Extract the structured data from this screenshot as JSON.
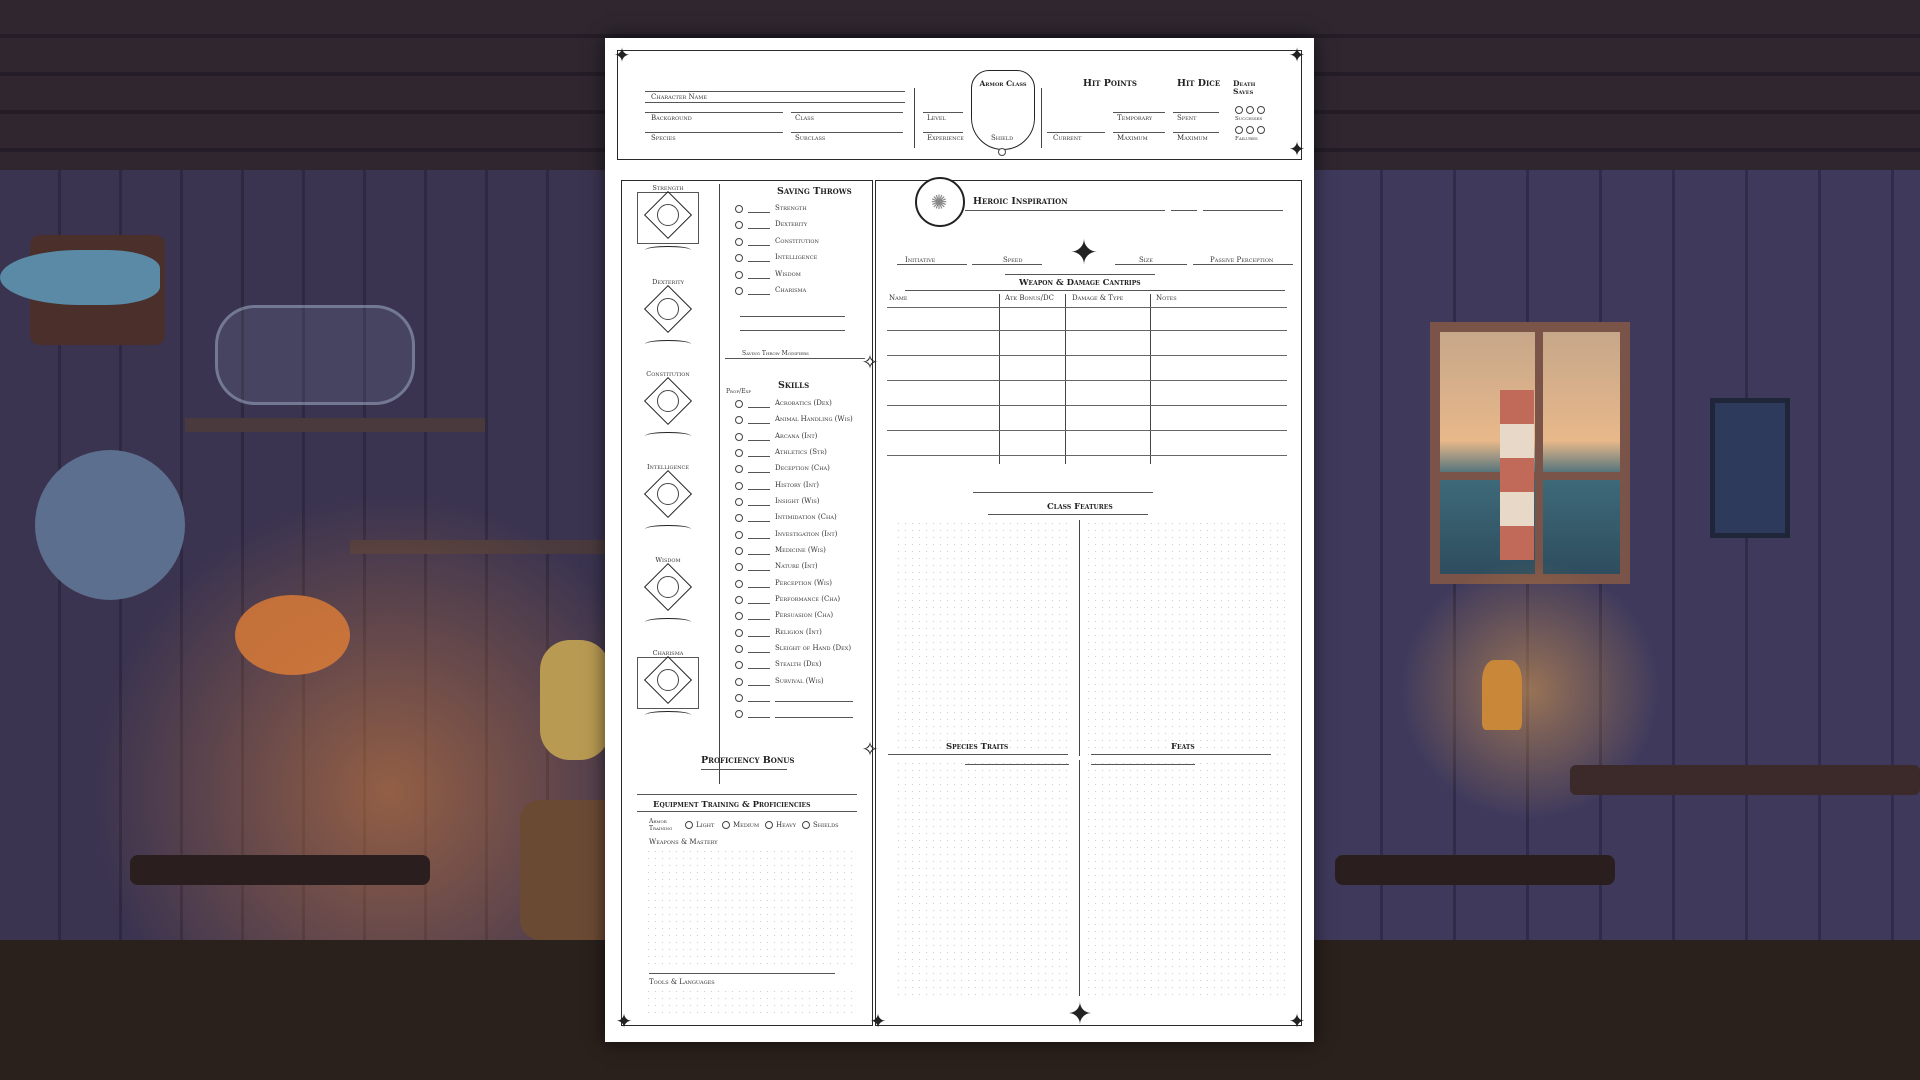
{
  "header": {
    "character_name": "Character Name",
    "background": "Background",
    "class": "Class",
    "species": "Species",
    "subclass": "Subclass",
    "level": "Level",
    "experience": "Experience",
    "armor_class": "Armor Class",
    "shield": "Shield",
    "hit_points": "Hit Points",
    "current": "Current",
    "temporary": "Temporary",
    "maximum": "Maximum",
    "hit_dice": "Hit Dice",
    "spent": "Spent",
    "hd_maximum": "Maximum",
    "death_saves": "Death Saves",
    "successes": "Successes",
    "failures": "Failures"
  },
  "abilities": [
    "Strength",
    "Dexterity",
    "Constitution",
    "Intelligence",
    "Wisdom",
    "Charisma"
  ],
  "saving_throws": {
    "title": "Saving Throws",
    "items": [
      "Strength",
      "Dexterity",
      "Constitution",
      "Intelligence",
      "Wisdom",
      "Charisma"
    ],
    "modifiers_label": "Saving Throw Modifiers"
  },
  "skills": {
    "title": "Skills",
    "prof_label": "Prof/Exp",
    "items": [
      "Acrobatics (Dex)",
      "Animal Handling (Wis)",
      "Arcana (Int)",
      "Athletics (Str)",
      "Deception (Cha)",
      "History (Int)",
      "Insight (Wis)",
      "Intimidation (Cha)",
      "Investigation (Int)",
      "Medicine (Wis)",
      "Nature (Int)",
      "Perception (Wis)",
      "Performance (Cha)",
      "Persuasion (Cha)",
      "Religion (Int)",
      "Sleight of Hand (Dex)",
      "Stealth (Dex)",
      "Survival (Wis)"
    ]
  },
  "proficiency_bonus": "Proficiency Bonus",
  "equipment": {
    "title": "Equipment Training & Proficiencies",
    "armor_training": "Armor Training",
    "options": [
      "Light",
      "Medium",
      "Heavy",
      "Shields"
    ],
    "weapons": "Weapons & Mastery",
    "tools": "Tools & Languages"
  },
  "heroic_inspiration": "Heroic Inspiration",
  "combat": [
    "Initiative",
    "Speed",
    "Size",
    "Passive Perception"
  ],
  "weapons_table": {
    "title": "Weapon & Damage Cantrips",
    "columns": [
      "Name",
      "Atk Bonus/DC",
      "Damage & Type",
      "Notes"
    ]
  },
  "class_features": "Class Features",
  "species_traits": "Species Traits",
  "feats": "Feats"
}
